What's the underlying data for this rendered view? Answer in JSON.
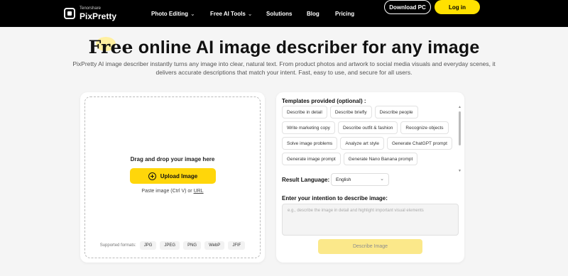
{
  "nav": {
    "brand_small": "Tenorshare",
    "brand_name": "PixPretty",
    "items": [
      {
        "label": "Photo Editing",
        "has_dropdown": true
      },
      {
        "label": "Free AI Tools",
        "has_dropdown": true
      },
      {
        "label": "Solutions",
        "has_dropdown": false
      },
      {
        "label": "Blog",
        "has_dropdown": false
      },
      {
        "label": "Pricing",
        "has_dropdown": false
      }
    ],
    "download_label": "Download PC",
    "login_label": "Log in"
  },
  "hero": {
    "title_highlight": "Free",
    "title_rest": " online AI image describer for any image",
    "subtitle": "PixPretty AI image describer instantly turns any image into clear, natural text. From product photos and artwork to social media visuals and everyday scenes, it delivers accurate descriptions that match your intent. Fast, easy to use, and secure for all users."
  },
  "upload": {
    "drag_text": "Drag and drop your image here",
    "button_label": "Upload Image",
    "paste_prefix": "Paste image (Ctrl V) or ",
    "paste_url": "URL",
    "formats_label": "Supported formats:",
    "formats": [
      "JPG",
      "JPEG",
      "PNG",
      "WebP",
      "JFIF"
    ]
  },
  "options": {
    "templates_heading": "Templates provided (optional) :",
    "templates": [
      "Describe in detail",
      "Describe briefly",
      "Describe people",
      "Write marketing copy",
      "Describe outfit & fashion",
      "Recognize objects",
      "Solve image problems",
      "Analyze art style",
      "Generate ChatGPT prompt",
      "Generate image prompt",
      "Generate Nano Banana prompt"
    ],
    "language_label": "Result Language:",
    "language_value": "English",
    "intent_label": "Enter your intention to describe image:",
    "intent_placeholder": "e.g., describe the image in detail and highlight important visual elements",
    "describe_button": "Describe Image"
  },
  "colors": {
    "accent_yellow": "#ffd60a",
    "nav_background": "#000000",
    "disabled_button": "#fbe88a"
  }
}
